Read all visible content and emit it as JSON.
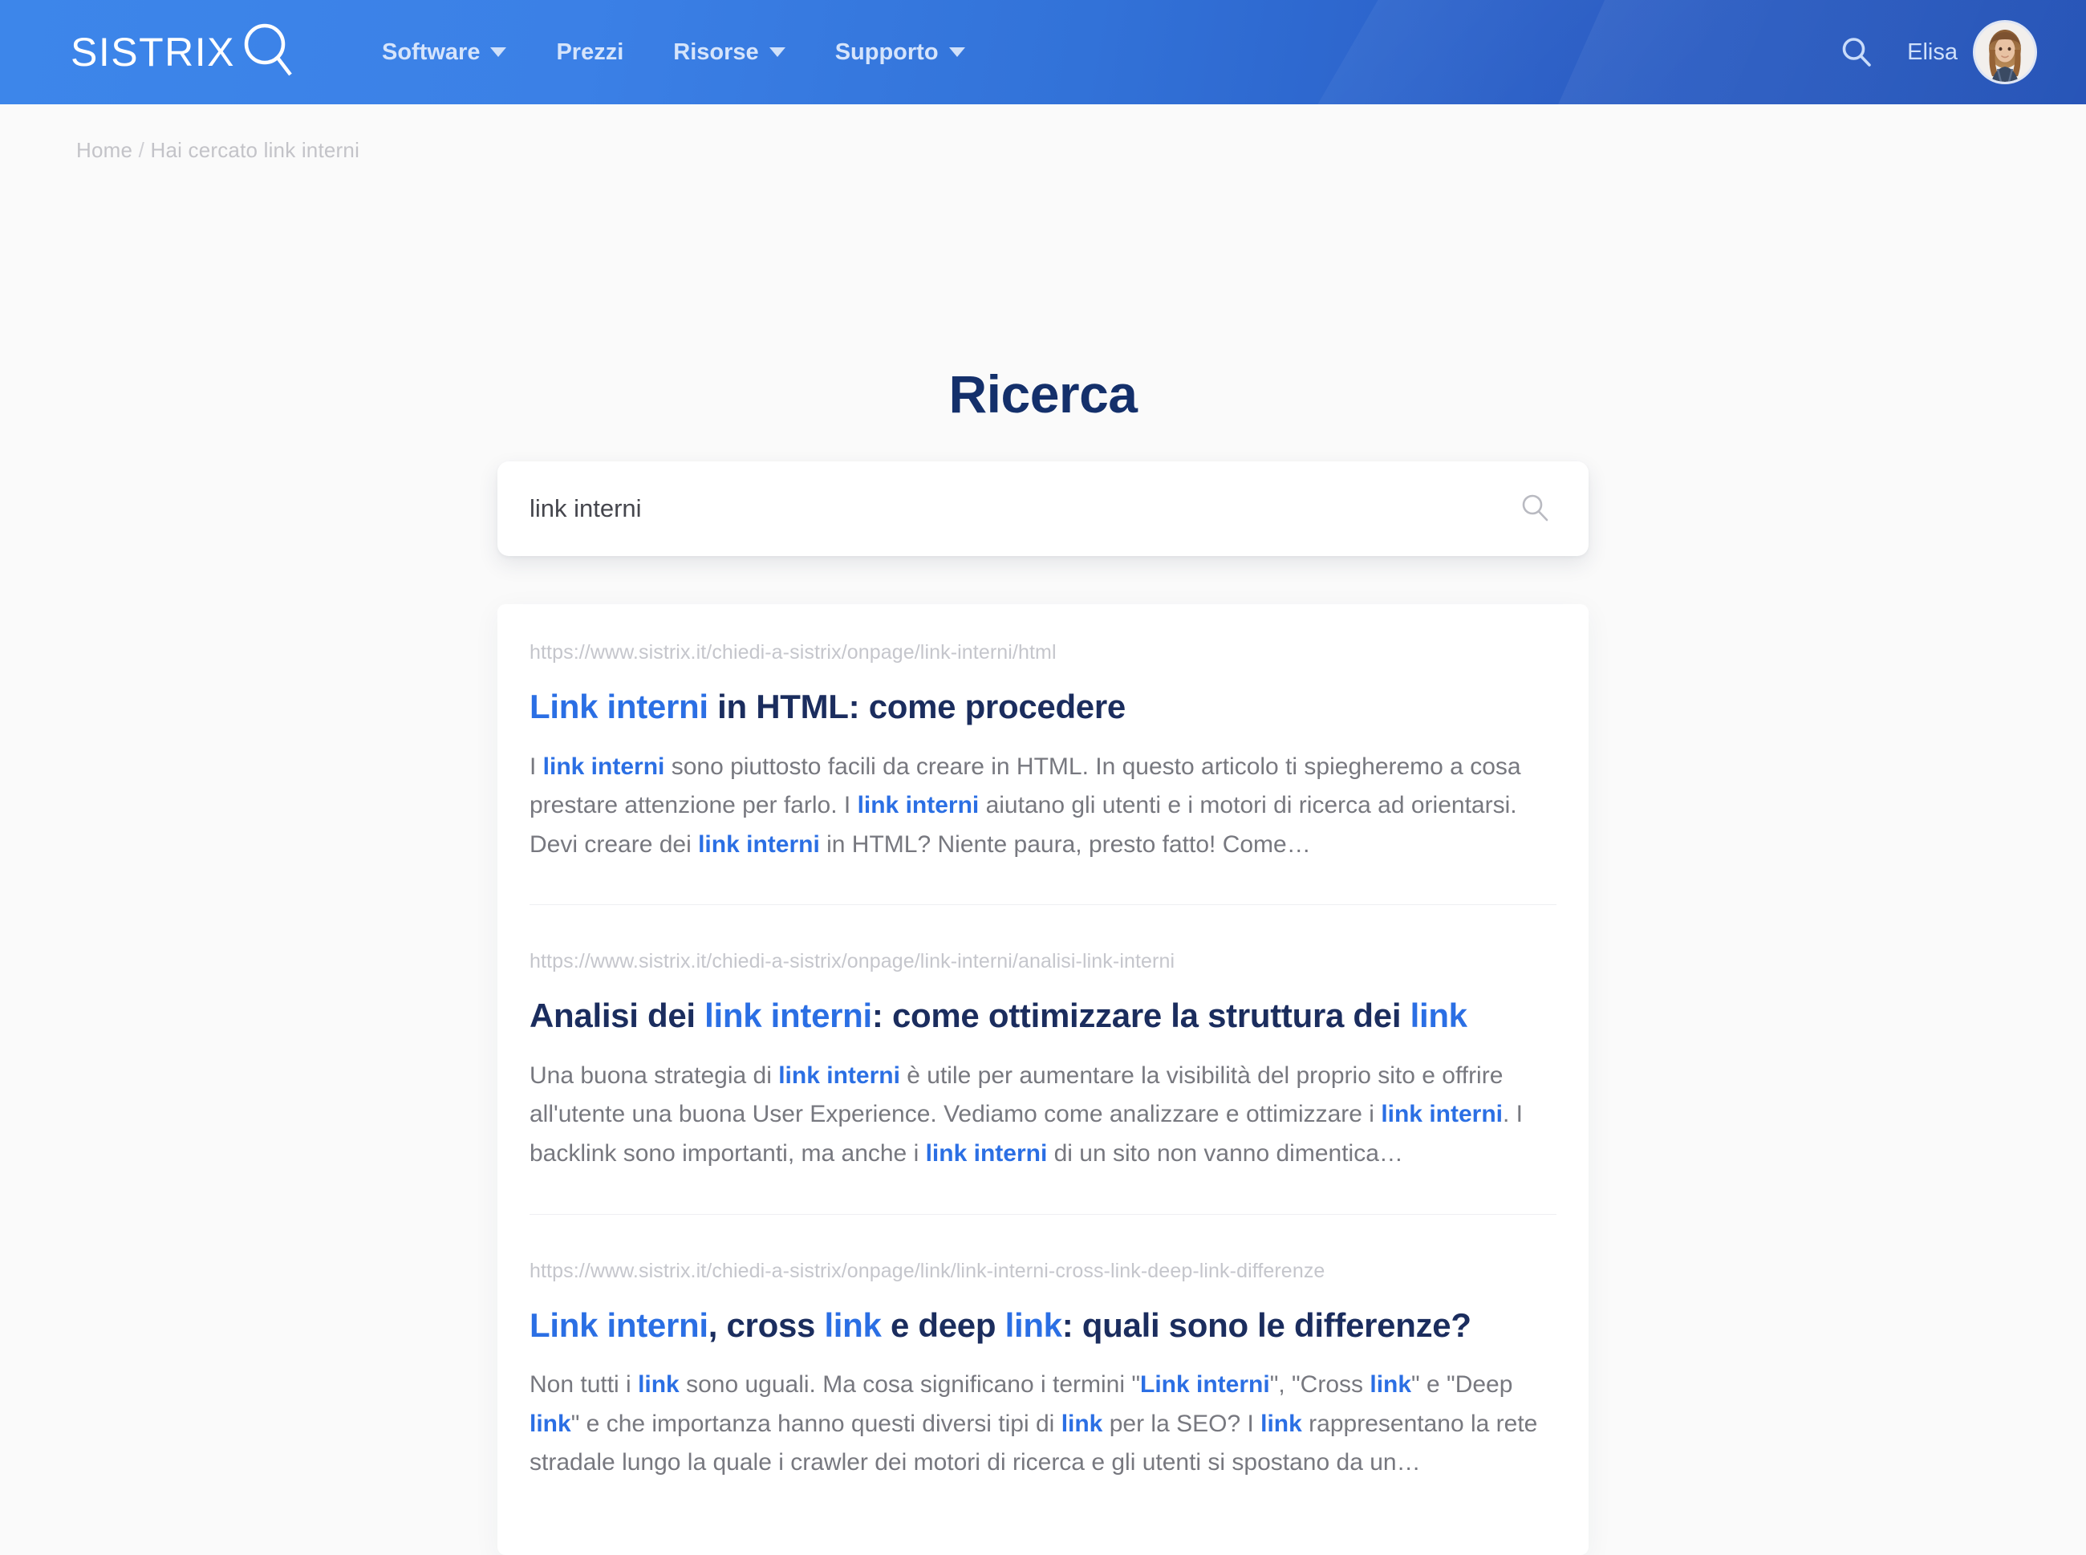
{
  "header": {
    "logo_text": "SISTRIX",
    "logo_icon": "magnifier-icon",
    "nav": [
      {
        "label": "Software",
        "has_dropdown": true
      },
      {
        "label": "Prezzi",
        "has_dropdown": false
      },
      {
        "label": "Risorse",
        "has_dropdown": true
      },
      {
        "label": "Supporto",
        "has_dropdown": true
      }
    ],
    "search_icon": "search-icon",
    "user_name": "Elisa",
    "avatar_alt": "avatar"
  },
  "breadcrumb": {
    "home": "Home",
    "separator": "/",
    "current": "Hai cercato link interni"
  },
  "main": {
    "title": "Ricerca",
    "search": {
      "value": "link interni",
      "placeholder": "link interni",
      "submit_icon": "search-icon"
    },
    "results": [
      {
        "url": "https://www.sistrix.it/chiedi-a-sistrix/onpage/link-interni/html",
        "title_parts": [
          {
            "text": "Link interni",
            "hl": true
          },
          {
            "text": " in HTML: come procedere",
            "hl": false
          }
        ],
        "snippet_parts": [
          {
            "text": "I ",
            "hl": false
          },
          {
            "text": "link interni",
            "hl": true
          },
          {
            "text": " sono piuttosto facili da creare in HTML. In questo articolo ti spiegheremo a cosa prestare attenzione per farlo. I ",
            "hl": false
          },
          {
            "text": "link interni",
            "hl": true
          },
          {
            "text": " aiutano gli utenti e i motori di ricerca ad orientarsi. Devi creare dei ",
            "hl": false
          },
          {
            "text": "link interni",
            "hl": true
          },
          {
            "text": " in HTML? Niente paura, presto fatto! Come…",
            "hl": false
          }
        ]
      },
      {
        "url": "https://www.sistrix.it/chiedi-a-sistrix/onpage/link-interni/analisi-link-interni",
        "title_parts": [
          {
            "text": "Analisi dei ",
            "hl": false
          },
          {
            "text": "link interni",
            "hl": true
          },
          {
            "text": ": come ottimizzare la struttura dei ",
            "hl": false
          },
          {
            "text": "link",
            "hl": true
          }
        ],
        "snippet_parts": [
          {
            "text": "Una buona strategia di ",
            "hl": false
          },
          {
            "text": "link interni",
            "hl": true
          },
          {
            "text": " è utile per aumentare la visibilità del proprio sito e offrire all'utente una buona User Experience. Vediamo come analizzare e ottimizzare i ",
            "hl": false
          },
          {
            "text": "link interni",
            "hl": true
          },
          {
            "text": ". I backlink sono importanti, ma anche i ",
            "hl": false
          },
          {
            "text": "link interni",
            "hl": true
          },
          {
            "text": " di un sito non vanno dimentica…",
            "hl": false
          }
        ]
      },
      {
        "url": "https://www.sistrix.it/chiedi-a-sistrix/onpage/link/link-interni-cross-link-deep-link-differenze",
        "title_parts": [
          {
            "text": "Link interni",
            "hl": true
          },
          {
            "text": ", cross ",
            "hl": false
          },
          {
            "text": "link",
            "hl": true
          },
          {
            "text": " e deep ",
            "hl": false
          },
          {
            "text": "link",
            "hl": true
          },
          {
            "text": ": quali sono le differenze?",
            "hl": false
          }
        ],
        "snippet_parts": [
          {
            "text": "Non tutti i ",
            "hl": false
          },
          {
            "text": "link",
            "hl": true
          },
          {
            "text": " sono uguali. Ma cosa significano i termini \"",
            "hl": false
          },
          {
            "text": "Link interni",
            "hl": true
          },
          {
            "text": "\", \"Cross ",
            "hl": false
          },
          {
            "text": "link",
            "hl": true
          },
          {
            "text": "\" e \"Deep ",
            "hl": false
          },
          {
            "text": "link",
            "hl": true
          },
          {
            "text": "\" e che importanza hanno questi diversi tipi di ",
            "hl": false
          },
          {
            "text": "link",
            "hl": true
          },
          {
            "text": " per la SEO? I ",
            "hl": false
          },
          {
            "text": "link",
            "hl": true
          },
          {
            "text": " rappresentano la rete stradale lungo la quale i crawler dei motori di ricerca e gli utenti si spostano da un…",
            "hl": false
          }
        ]
      }
    ]
  },
  "colors": {
    "header_gradient_start": "#3d86ea",
    "header_gradient_end": "#2654b7",
    "title_navy": "#14306b",
    "result_title_navy": "#1b2d5e",
    "highlight_blue": "#2b6fe4",
    "page_bg": "#fafafa",
    "muted_text": "#77787f",
    "url_gray": "#c5c6cc"
  }
}
